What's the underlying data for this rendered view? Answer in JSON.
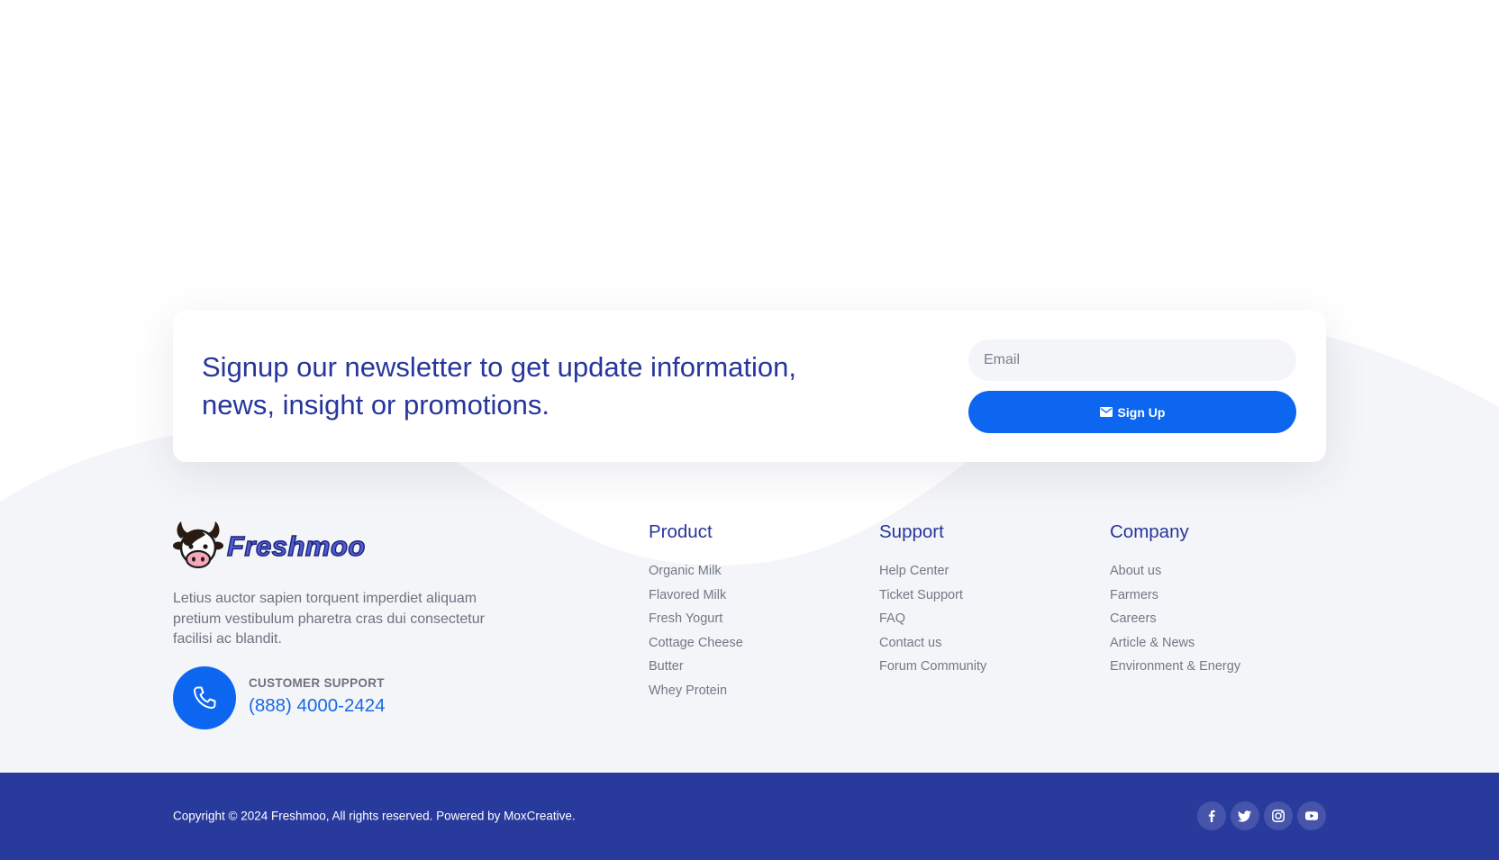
{
  "colors": {
    "primary": "#0d66f0",
    "heading": "#27369b",
    "bottom_bar": "#283a9c",
    "footer_bg": "#f4f5f8",
    "muted_text": "#6e7280"
  },
  "newsletter": {
    "heading": "Signup our newsletter to get update information, news, insight or promotions.",
    "email_placeholder": "Email",
    "signup_label": "Sign Up",
    "signup_icon": "mail-icon"
  },
  "brand": {
    "logo_text": "Freshmoo",
    "logo_icon": "cow-logo-icon",
    "description": "Letius auctor sapien torquent imperdiet aliquam pretium vestibulum pharetra cras dui consectetur facilisi ac blandit."
  },
  "support": {
    "icon": "phone-icon",
    "label": "CUSTOMER SUPPORT",
    "phone": "(888) 4000-2424"
  },
  "columns": [
    {
      "title": "Product",
      "links": [
        "Organic Milk",
        "Flavored Milk",
        "Fresh Yogurt",
        "Cottage Cheese",
        "Butter",
        "Whey Protein"
      ]
    },
    {
      "title": "Support",
      "links": [
        "Help Center",
        "Ticket Support",
        "FAQ",
        "Contact us",
        "Forum Community"
      ]
    },
    {
      "title": "Company",
      "links": [
        "About us",
        "Farmers",
        "Careers",
        "Article & News",
        "Environment & Energy"
      ]
    }
  ],
  "bottom_bar": {
    "copyright": "Copyright © 2024 Freshmoo, All rights reserved. Powered by MoxCreative.",
    "social": [
      "facebook-icon",
      "twitter-icon",
      "instagram-icon",
      "youtube-icon"
    ]
  }
}
